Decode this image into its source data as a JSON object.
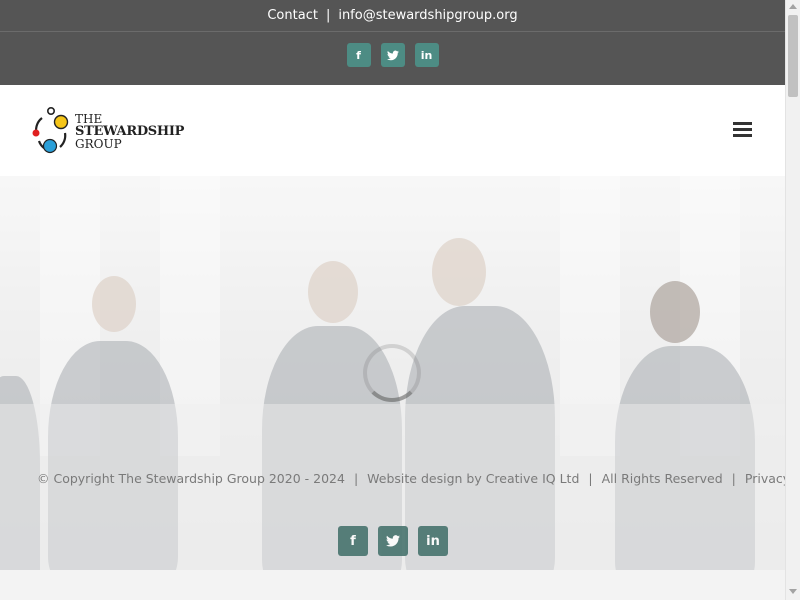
{
  "topbar": {
    "contact_label": "Contact",
    "separator": "|",
    "email": "info@stewardshipgroup.org",
    "social": [
      {
        "icon": "facebook-icon",
        "glyph": "f"
      },
      {
        "icon": "twitter-icon",
        "glyph": "t"
      },
      {
        "icon": "linkedin-icon",
        "glyph": "in"
      }
    ]
  },
  "header": {
    "logo_line1": "THE",
    "logo_line2": "STEWARDSHIP",
    "logo_line3": "GROUP",
    "menu_icon": "hamburger-menu-icon"
  },
  "footer": {
    "copyright": "© Copyright The Stewardship Group 2020 - 2024",
    "sep": "|",
    "design": "Website design by Creative IQ Ltd",
    "rights": "All Rights Reserved",
    "privacy": "Privacy Policy",
    "social": [
      {
        "icon": "facebook-icon",
        "glyph": "f"
      },
      {
        "icon": "twitter-icon",
        "glyph": "t"
      },
      {
        "icon": "linkedin-icon",
        "glyph": "in"
      }
    ]
  },
  "colors": {
    "topbar_bg": "#555555",
    "social_accent": "#4d8c84",
    "logo_red": "#e02020",
    "logo_yellow": "#f5c518",
    "logo_blue": "#2a9fd8"
  }
}
